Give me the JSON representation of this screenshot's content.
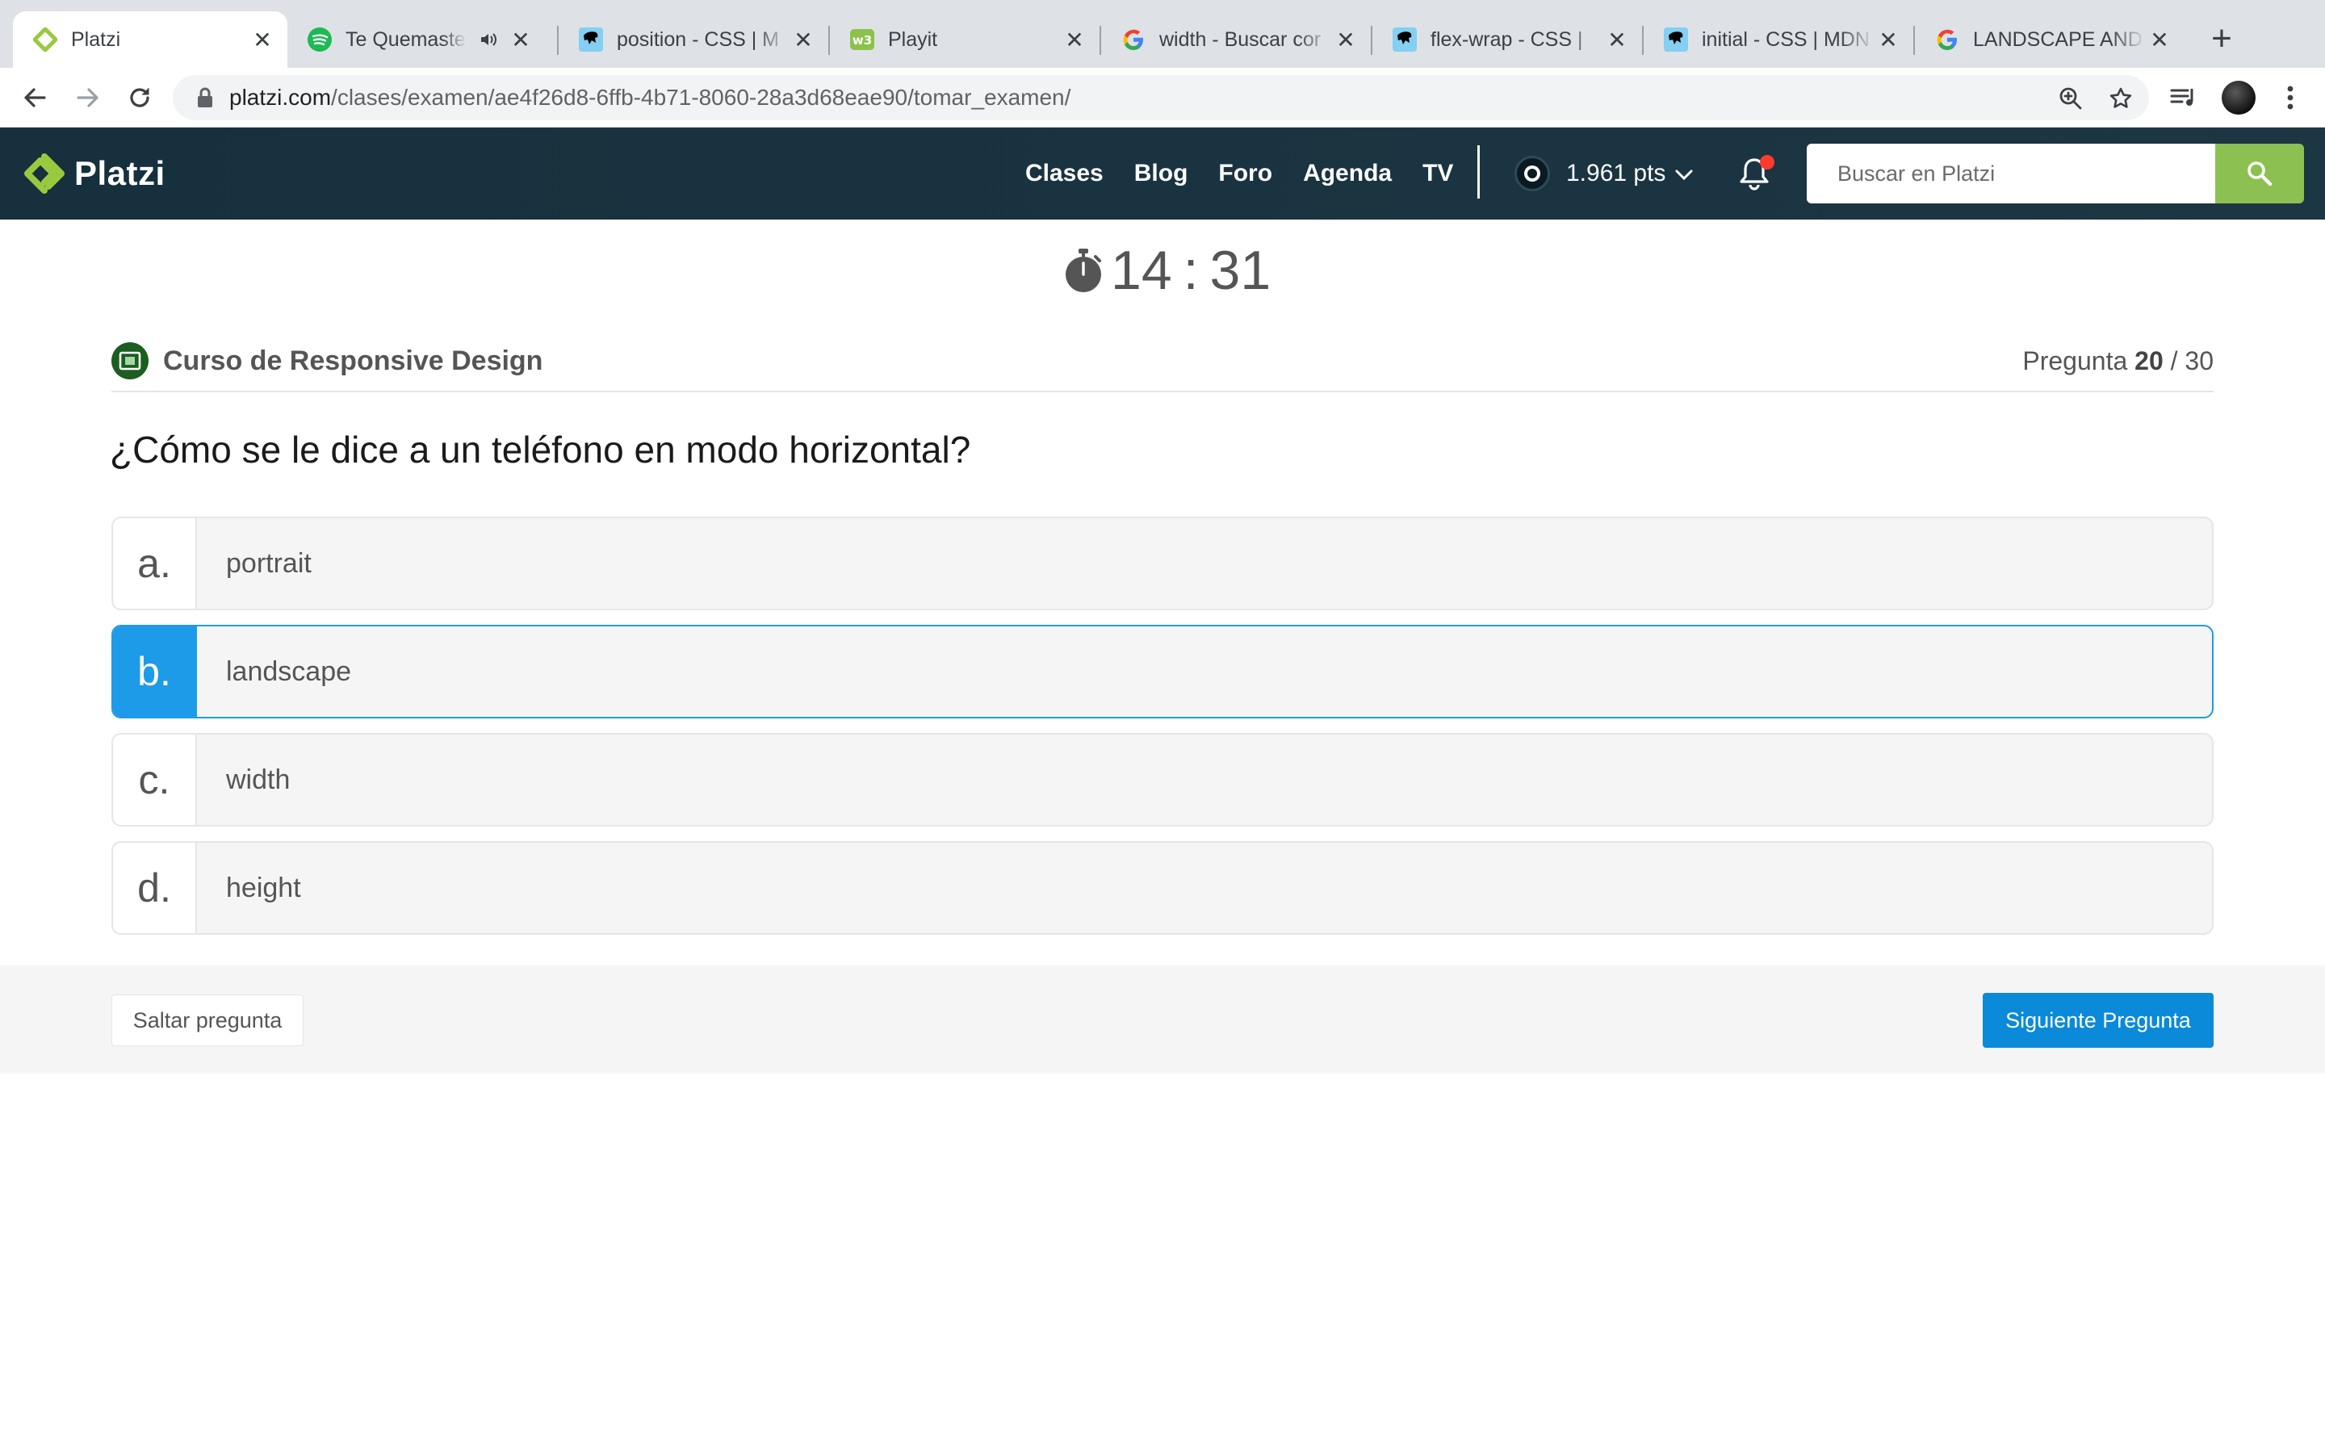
{
  "browser": {
    "tabs": [
      {
        "title": "Platzi",
        "icon": "platzi-icon",
        "active": true
      },
      {
        "title": "Te Quemaste",
        "icon": "spotify-icon",
        "audio": true
      },
      {
        "title": "position - CSS | M",
        "icon": "mdn-icon"
      },
      {
        "title": "Playit",
        "icon": "playit-icon"
      },
      {
        "title": "width - Buscar cor",
        "icon": "google-icon"
      },
      {
        "title": "flex-wrap - CSS |",
        "icon": "mdn-icon"
      },
      {
        "title": "initial - CSS | MDN",
        "icon": "mdn-icon"
      },
      {
        "title": "LANDSCAPE AND",
        "icon": "google-icon"
      }
    ],
    "url_host": "platzi.com",
    "url_path": "/clases/examen/ae4f26d8-6ffb-4b71-8060-28a3d68eae90/tomar_examen/"
  },
  "header": {
    "logo_text": "Platzi",
    "nav": [
      "Clases",
      "Blog",
      "Foro",
      "Agenda",
      "TV"
    ],
    "points": "1.961 pts",
    "search_placeholder": "Buscar en Platzi",
    "brand_green": "#98ca3f",
    "search_button_color": "#8cc152"
  },
  "exam": {
    "timer_minutes": "14",
    "timer_separator": ":",
    "timer_seconds": "31",
    "course_title": "Curso de Responsive Design",
    "counter_label": "Pregunta",
    "counter_current": "20",
    "counter_separator": "/",
    "counter_total": "30",
    "question": "¿Cómo se le dice a un teléfono en modo horizontal?",
    "options": [
      {
        "letter": "a.",
        "text": "portrait",
        "selected": false
      },
      {
        "letter": "b.",
        "text": "landscape",
        "selected": true
      },
      {
        "letter": "c.",
        "text": "width",
        "selected": false
      },
      {
        "letter": "d.",
        "text": "height",
        "selected": false
      }
    ],
    "skip_label": "Saltar pregunta",
    "next_label": "Siguiente Pregunta",
    "selected_color": "#1e9be8",
    "next_button_color": "#0a8ad9"
  }
}
